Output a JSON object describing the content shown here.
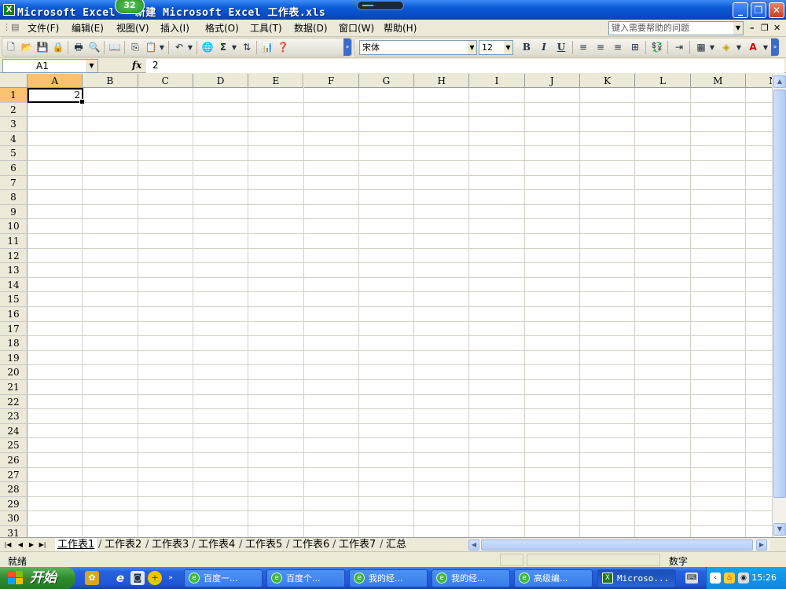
{
  "window": {
    "title": "Microsoft Excel - 新建 Microsoft Excel 工作表.xls",
    "badge": "32",
    "buttons": {
      "minimize": "_",
      "restore": "❐",
      "close": "✕"
    }
  },
  "menu": {
    "items": [
      "文件(F)",
      "编辑(E)",
      "视图(V)",
      "插入(I)",
      "格式(O)",
      "工具(T)",
      "数据(D)",
      "窗口(W)",
      "帮助(H)"
    ],
    "help_placeholder": "键入需要帮助的问题",
    "doc_controls": [
      "–",
      "❐",
      "✕"
    ]
  },
  "toolbar": {
    "font_name": "宋体",
    "font_size": "12",
    "bold": "B",
    "italic": "I",
    "underline": "U",
    "sum": "Σ"
  },
  "formula_bar": {
    "name_box": "A1",
    "fx": "fx",
    "value": "2"
  },
  "sheet": {
    "columns": [
      "A",
      "B",
      "C",
      "D",
      "E",
      "F",
      "G",
      "H",
      "I",
      "J",
      "K",
      "L",
      "M",
      "N"
    ],
    "rows": [
      "1",
      "2",
      "3",
      "4",
      "5",
      "6",
      "7",
      "8",
      "9",
      "10",
      "11",
      "12",
      "13",
      "14",
      "15",
      "16",
      "17",
      "18",
      "19",
      "20",
      "21",
      "22",
      "23",
      "24",
      "25",
      "26",
      "27",
      "28",
      "29",
      "30",
      "31"
    ],
    "selected_cell": "A1",
    "a1_value": "2"
  },
  "tabs": [
    "工作表1",
    "工作表2",
    "工作表3",
    "工作表4",
    "工作表5",
    "工作表6",
    "工作表7",
    "汇总"
  ],
  "status": {
    "ready": "就绪",
    "mode": "数字"
  },
  "taskbar": {
    "start": "开始",
    "tasks": [
      "百度一...",
      "百度个...",
      "我的经...",
      "我的经...",
      "高级编...",
      "Microso..."
    ],
    "clock": "15:26"
  },
  "colors": {
    "titlebar": "#0a5ad6",
    "selected_header": "#f9c26e",
    "taskbar": "#2154d4",
    "start": "#2e8b2e"
  }
}
